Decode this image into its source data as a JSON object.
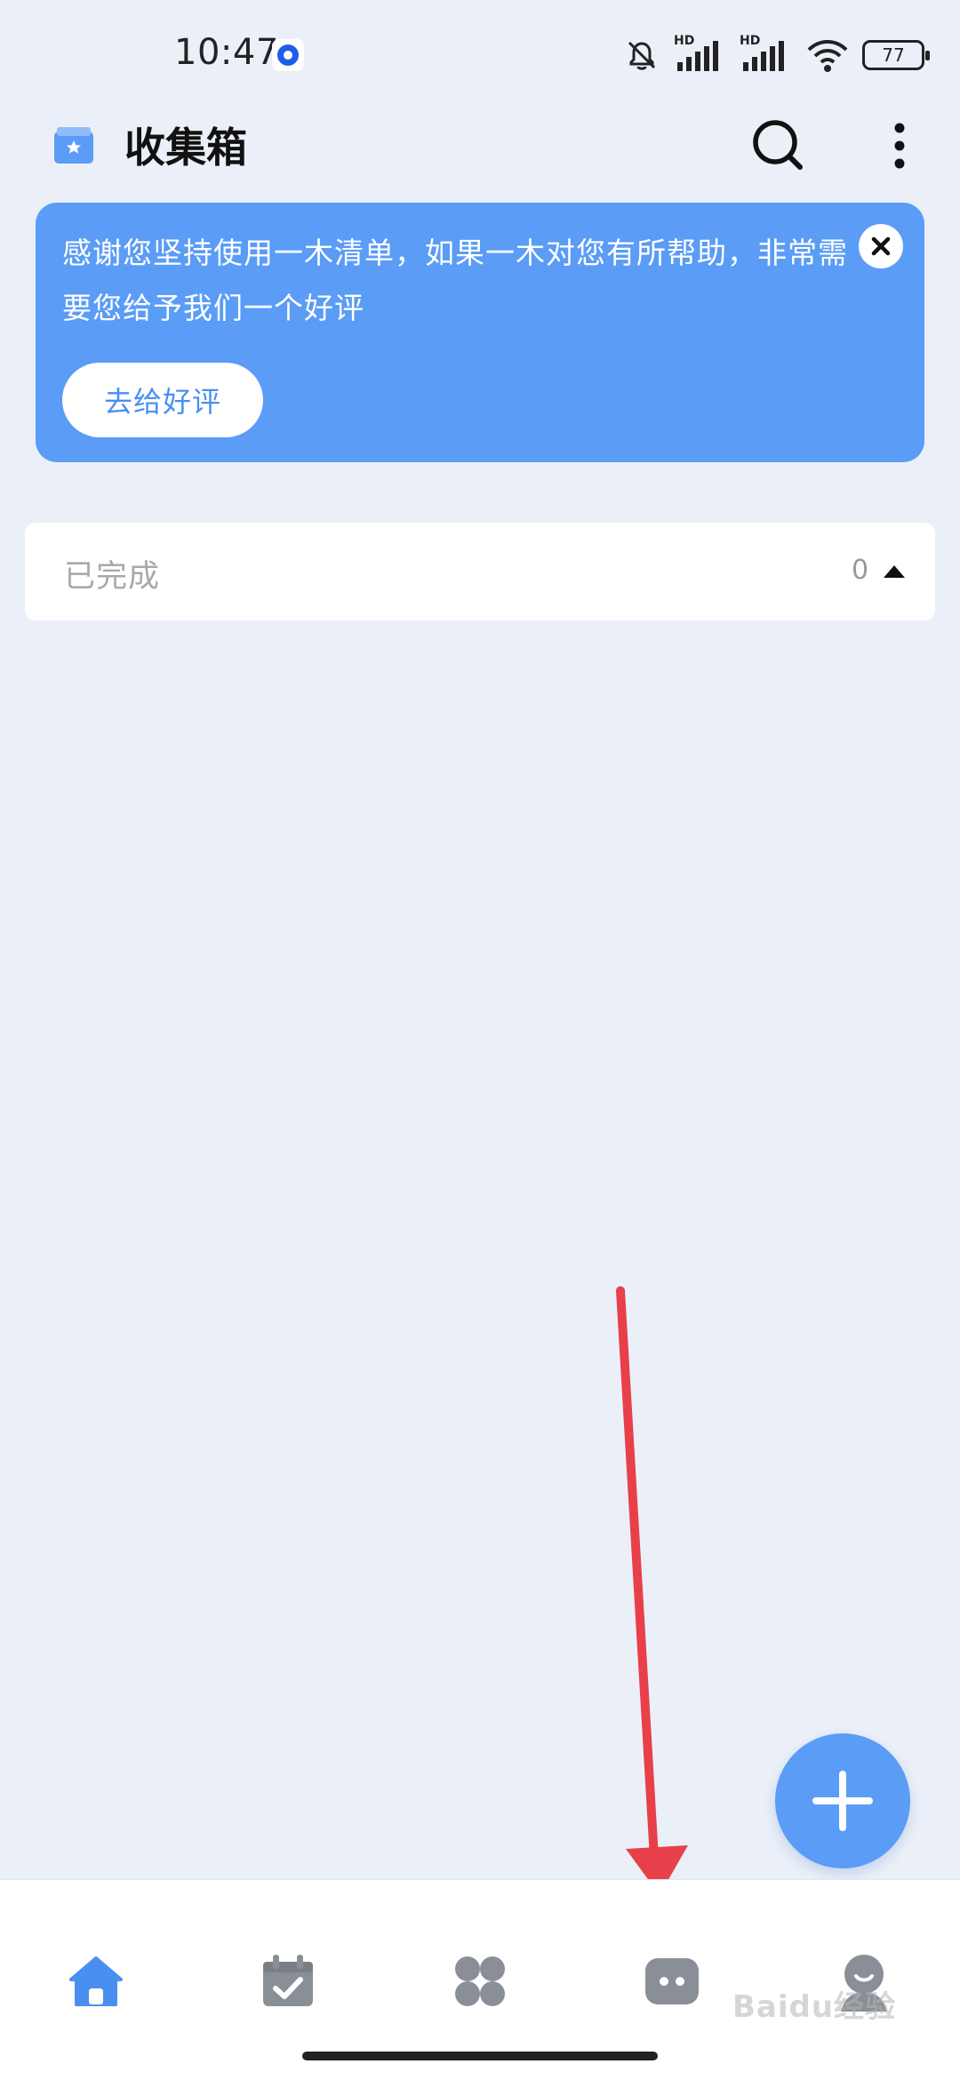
{
  "status_bar": {
    "time": "10:47",
    "battery": "77",
    "network_1": "HD",
    "network_2": "HD"
  },
  "header": {
    "title": "收集箱"
  },
  "banner": {
    "text": "感谢您坚持使用一木清单，如果一木对您有所帮助，非常需要您给予我们一个好评",
    "button_label": "去给好评"
  },
  "completed": {
    "label": "已完成",
    "count": "0"
  },
  "bottom_nav": {
    "items": [
      "home-icon",
      "calendar-check-icon",
      "apps-grid-icon",
      "chat-bubble-icon",
      "profile-icon"
    ]
  },
  "watermark": "Baidu经验",
  "colors": {
    "accent": "#5a9cf6",
    "background": "#ebf0f8",
    "annotation": "#e8404a"
  }
}
